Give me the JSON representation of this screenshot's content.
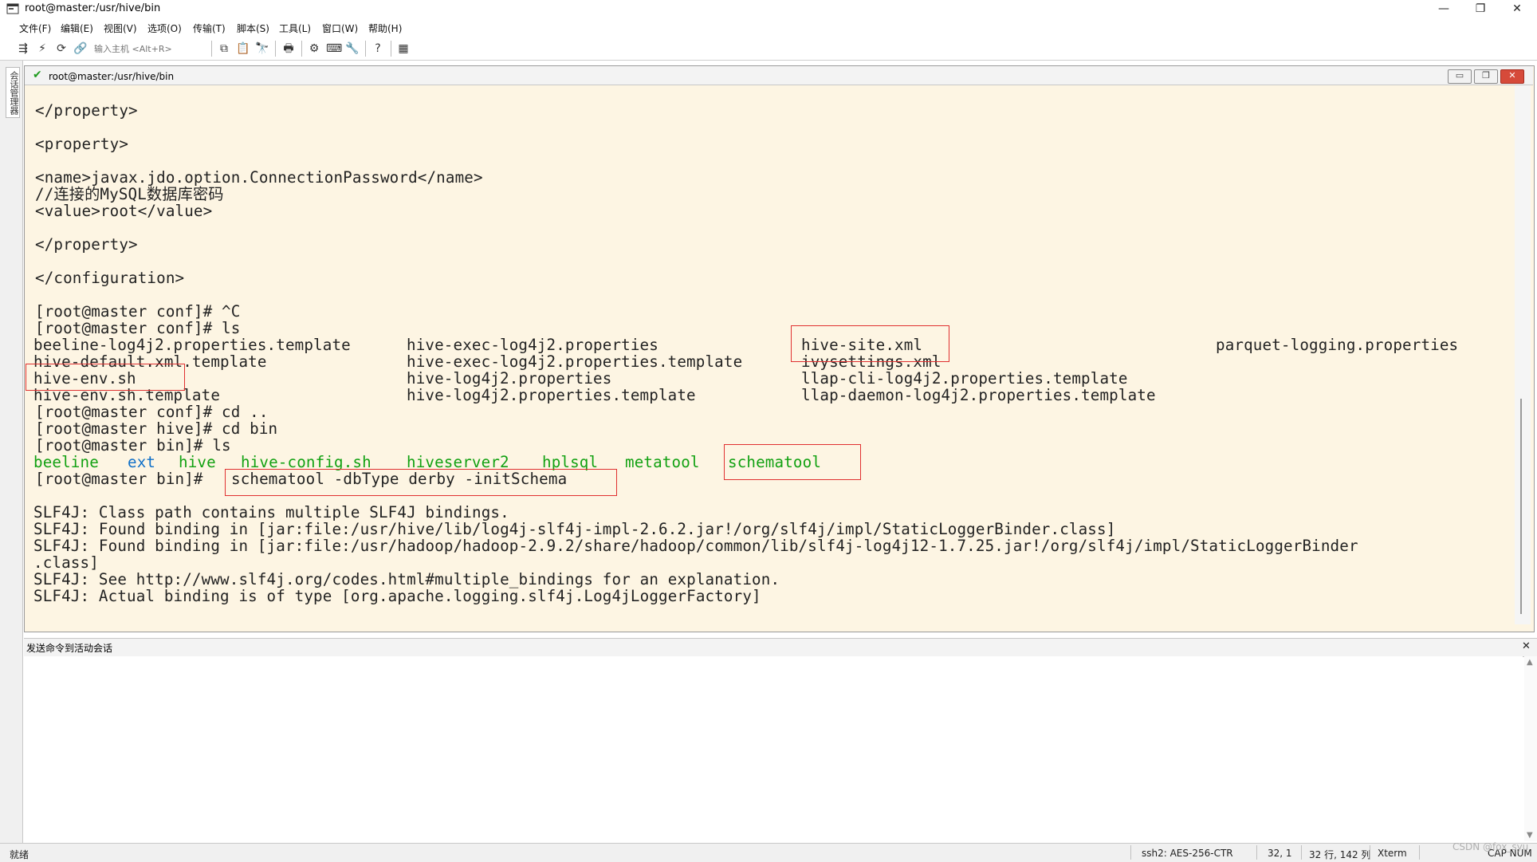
{
  "window": {
    "title": "root@master:/usr/hive/bin",
    "min_icon": "minimize-icon",
    "max_icon": "restore-icon",
    "close_icon": "close-icon"
  },
  "menu": [
    "文件(F)",
    "编辑(E)",
    "视图(V)",
    "选项(O)",
    "传输(T)",
    "脚本(S)",
    "工具(L)",
    "窗口(W)",
    "帮助(H)"
  ],
  "toolbar": {
    "host_placeholder": "输入主机 <Alt+R>"
  },
  "left_strip": {
    "session_manager_label": "会话管理器"
  },
  "session": {
    "title": "root@master:/usr/hive/bin",
    "status_icon": "check-icon"
  },
  "terminal": {
    "lines": [
      "</property>",
      "",
      "<property>",
      "",
      "<name>javax.jdo.option.ConnectionPassword</name>",
      "//连接的MySQL数据库密码",
      "<value>root</value>",
      "",
      "</property>",
      "",
      "</configuration>",
      "",
      "[root@master conf]# ^C",
      "[root@master conf]# ls"
    ],
    "ls_conf": [
      [
        "beeline-log4j2.properties.template",
        "hive-exec-log4j2.properties",
        "hive-site.xml",
        "parquet-logging.properties"
      ],
      [
        "hive-default.xml.template",
        "hive-exec-log4j2.properties.template",
        "ivysettings.xml",
        ""
      ],
      [
        "hive-env.sh",
        "hive-log4j2.properties",
        "llap-cli-log4j2.properties.template",
        ""
      ],
      [
        "hive-env.sh.template",
        "hive-log4j2.properties.template",
        "llap-daemon-log4j2.properties.template",
        ""
      ]
    ],
    "cd_lines": [
      "[root@master conf]# cd ..",
      "[root@master hive]# cd bin",
      "[root@master bin]# ls"
    ],
    "ls_bin": [
      "beeline",
      "ext",
      "hive",
      "hive-config.sh",
      "hiveserver2",
      "hplsql",
      "metatool",
      "schematool"
    ],
    "prompt": "[root@master bin]# ",
    "command": "schematool -dbType derby -initSchema",
    "output": [
      "",
      "SLF4J: Class path contains multiple SLF4J bindings.",
      "SLF4J: Found binding in [jar:file:/usr/hive/lib/log4j-slf4j-impl-2.6.2.jar!/org/slf4j/impl/StaticLoggerBinder.class]",
      "SLF4J: Found binding in [jar:file:/usr/hadoop/hadoop-2.9.2/share/hadoop/common/lib/slf4j-log4j12-1.7.25.jar!/org/slf4j/impl/StaticLoggerBinder",
      ".class]",
      "SLF4J: See http://www.slf4j.org/codes.html#multiple_bindings for an explanation.",
      "SLF4J: Actual binding is of type [org.apache.logging.slf4j.Log4jLoggerFactory]"
    ]
  },
  "command_window": {
    "title": "发送命令到活动会话"
  },
  "status": {
    "ready": "就绪",
    "ssh": "ssh2: AES-256-CTR",
    "cursor": "32,  1",
    "rows_cols": "32 行, 142 列",
    "term": "Xterm",
    "caps": "CAP NUM"
  },
  "watermark": "CSDN @fox_syu",
  "colors": {
    "terminal_bg": "#fdf5e3",
    "exec_green": "#12a112",
    "dir_blue": "#1070c8",
    "highlight_red": "#e03030"
  }
}
